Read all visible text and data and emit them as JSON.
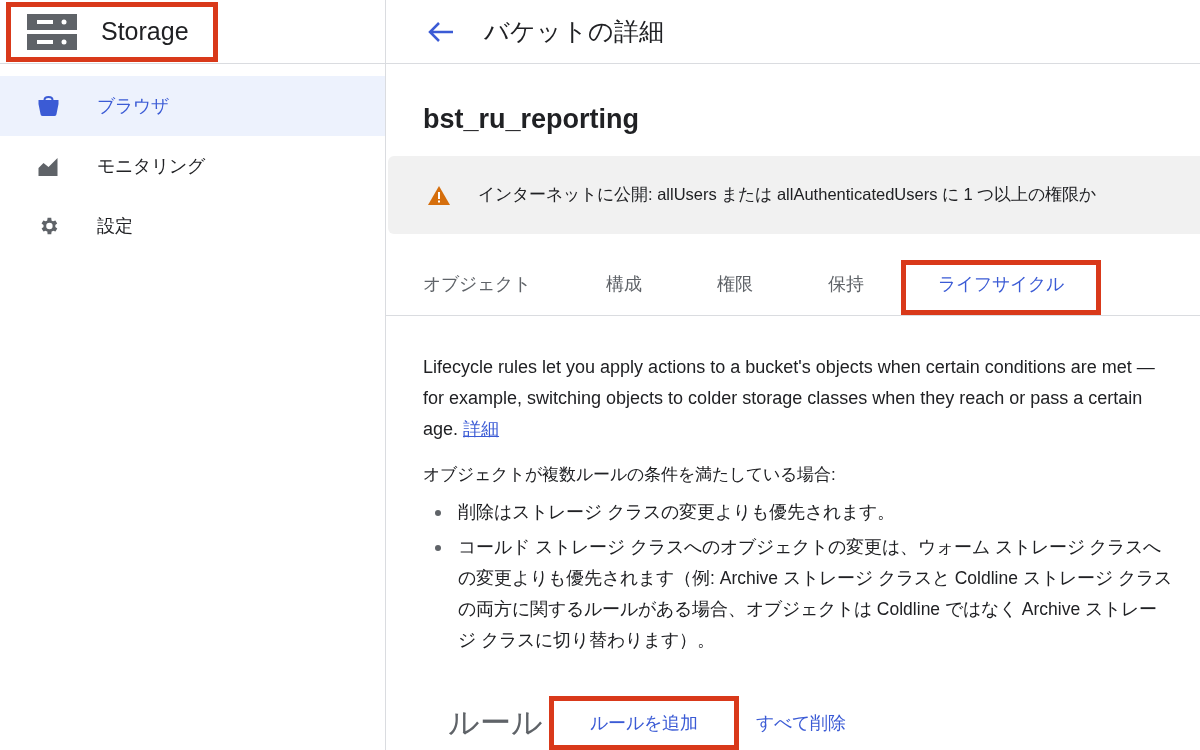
{
  "header": {
    "title": "Storage",
    "highlighted": true
  },
  "sidebar": {
    "items": [
      {
        "label": "ブラウザ",
        "selected": true
      },
      {
        "label": "モニタリング",
        "selected": false
      },
      {
        "label": "設定",
        "selected": false
      }
    ]
  },
  "page": {
    "title": "バケットの詳細"
  },
  "bucket": {
    "name": "bst_ru_reporting"
  },
  "warning": {
    "text": "インターネットに公開: allUsers または allAuthenticatedUsers に 1 つ以上の権限か"
  },
  "tabs": [
    {
      "label": "オブジェクト",
      "selected": false,
      "highlighted": false
    },
    {
      "label": "構成",
      "selected": false,
      "highlighted": false
    },
    {
      "label": "権限",
      "selected": false,
      "highlighted": false
    },
    {
      "label": "保持",
      "selected": false,
      "highlighted": false
    },
    {
      "label": "ライフサイクル",
      "selected": true,
      "highlighted": true
    }
  ],
  "intro": {
    "text": "Lifecycle rules let you apply actions to a bucket's objects when certain conditions are met — for example, switching objects to colder storage classes when they reach or pass a certain age.",
    "link": "詳細"
  },
  "conditions": {
    "lead": "オブジェクトが複数ルールの条件を満たしている場合:",
    "bullets": [
      "削除はストレージ クラスの変更よりも優先されます。",
      "コールド ストレージ クラスへのオブジェクトの変更は、ウォーム ストレージ クラスへの変更よりも優先されます（例: Archive ストレージ クラスと Coldline ストレージ クラスの両方に関するルールがある場合、オブジェクトは Coldline ではなく Archive ストレージ クラスに切り替わります）。"
    ]
  },
  "rules": {
    "title": "ルール",
    "actions": [
      {
        "label": "ルールを追加",
        "highlighted": true
      },
      {
        "label": "すべて削除",
        "highlighted": false
      }
    ]
  }
}
